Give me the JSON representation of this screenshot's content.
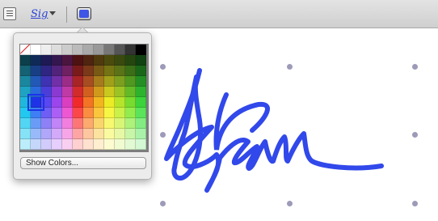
{
  "toolbar": {
    "signature_label": "Sig",
    "accent_color": "#3f55e6"
  },
  "icons": {
    "sidebar": "sidebar-icon",
    "signature": "signature-icon",
    "chevron": "chevron-down-icon",
    "color": "color-swatch-icon"
  },
  "color_popover": {
    "show_colors_label": "Show Colors...",
    "selected_color": "#1f33e6",
    "grid": [
      [
        "none",
        "#ffffff",
        "#eeeeee",
        "#dddddd",
        "#cccccc",
        "#bbbbbb",
        "#aaaaaa",
        "#999999",
        "#777777",
        "#555555",
        "#333333",
        "#000000"
      ],
      [
        "#0c3f4a",
        "#102a58",
        "#1e1a55",
        "#35174f",
        "#4a1640",
        "#4f1212",
        "#4f2410",
        "#4e3a0d",
        "#4b4b0d",
        "#3a4a0f",
        "#25470f",
        "#114211"
      ],
      [
        "#146273",
        "#183e85",
        "#2e2682",
        "#52237a",
        "#702161",
        "#7a1b1b",
        "#7a3919",
        "#785a14",
        "#747414",
        "#5a7316",
        "#3a6e17",
        "#1a671a"
      ],
      [
        "#1a879f",
        "#2258b6",
        "#3f33b3",
        "#7130a8",
        "#9c2d87",
        "#a82525",
        "#a84d22",
        "#a67b1b",
        "#a0a01b",
        "#7c9f1f",
        "#509820",
        "#248f24"
      ],
      [
        "#1ea3c2",
        "#2a6bdc",
        "#4b3ed8",
        "#8a3ad0",
        "#c03aa6",
        "#d12b2b",
        "#d1601f",
        "#cf9a1c",
        "#c9c91f",
        "#9bc424",
        "#62bb27",
        "#2eb32e"
      ],
      [
        "#1fb8dc",
        "#1f33e6",
        "#5a47f0",
        "#9b45ec",
        "#da3fbf",
        "#f02a2a",
        "#f27424",
        "#f1b51f",
        "#ecec26",
        "#b6e42b",
        "#78db2f",
        "#3cd33c"
      ],
      [
        "#22c8f0",
        "#3e7ff5",
        "#6e5ef6",
        "#ac5ff5",
        "#ed58d2",
        "#fb4747",
        "#fb8d41",
        "#f9c63c",
        "#f6f644",
        "#c9f14a",
        "#92ec4e",
        "#5be45b"
      ],
      [
        "#52d6f4",
        "#6a9cf7",
        "#8e81f8",
        "#c185f7",
        "#f27fdd",
        "#fc7676",
        "#fcaa6e",
        "#fad56d",
        "#f8f870",
        "#d9f577",
        "#adf27b",
        "#82ec82"
      ],
      [
        "#86e2f7",
        "#98bafa",
        "#b0a7fa",
        "#d3a9f9",
        "#f6a6e7",
        "#fda4a4",
        "#fdc69f",
        "#fbe29f",
        "#fafaa1",
        "#e6f8a5",
        "#c8f6a8",
        "#aaf2aa"
      ],
      [
        "#bcedfa",
        "#c6d7fc",
        "#d2ccfc",
        "#e6cffc",
        "#f9cff1",
        "#fed0d0",
        "#fee1cf",
        "#fdefcf",
        "#fcfcd0",
        "#f1fbd2",
        "#e2fad3",
        "#d3f8d3"
      ]
    ]
  }
}
